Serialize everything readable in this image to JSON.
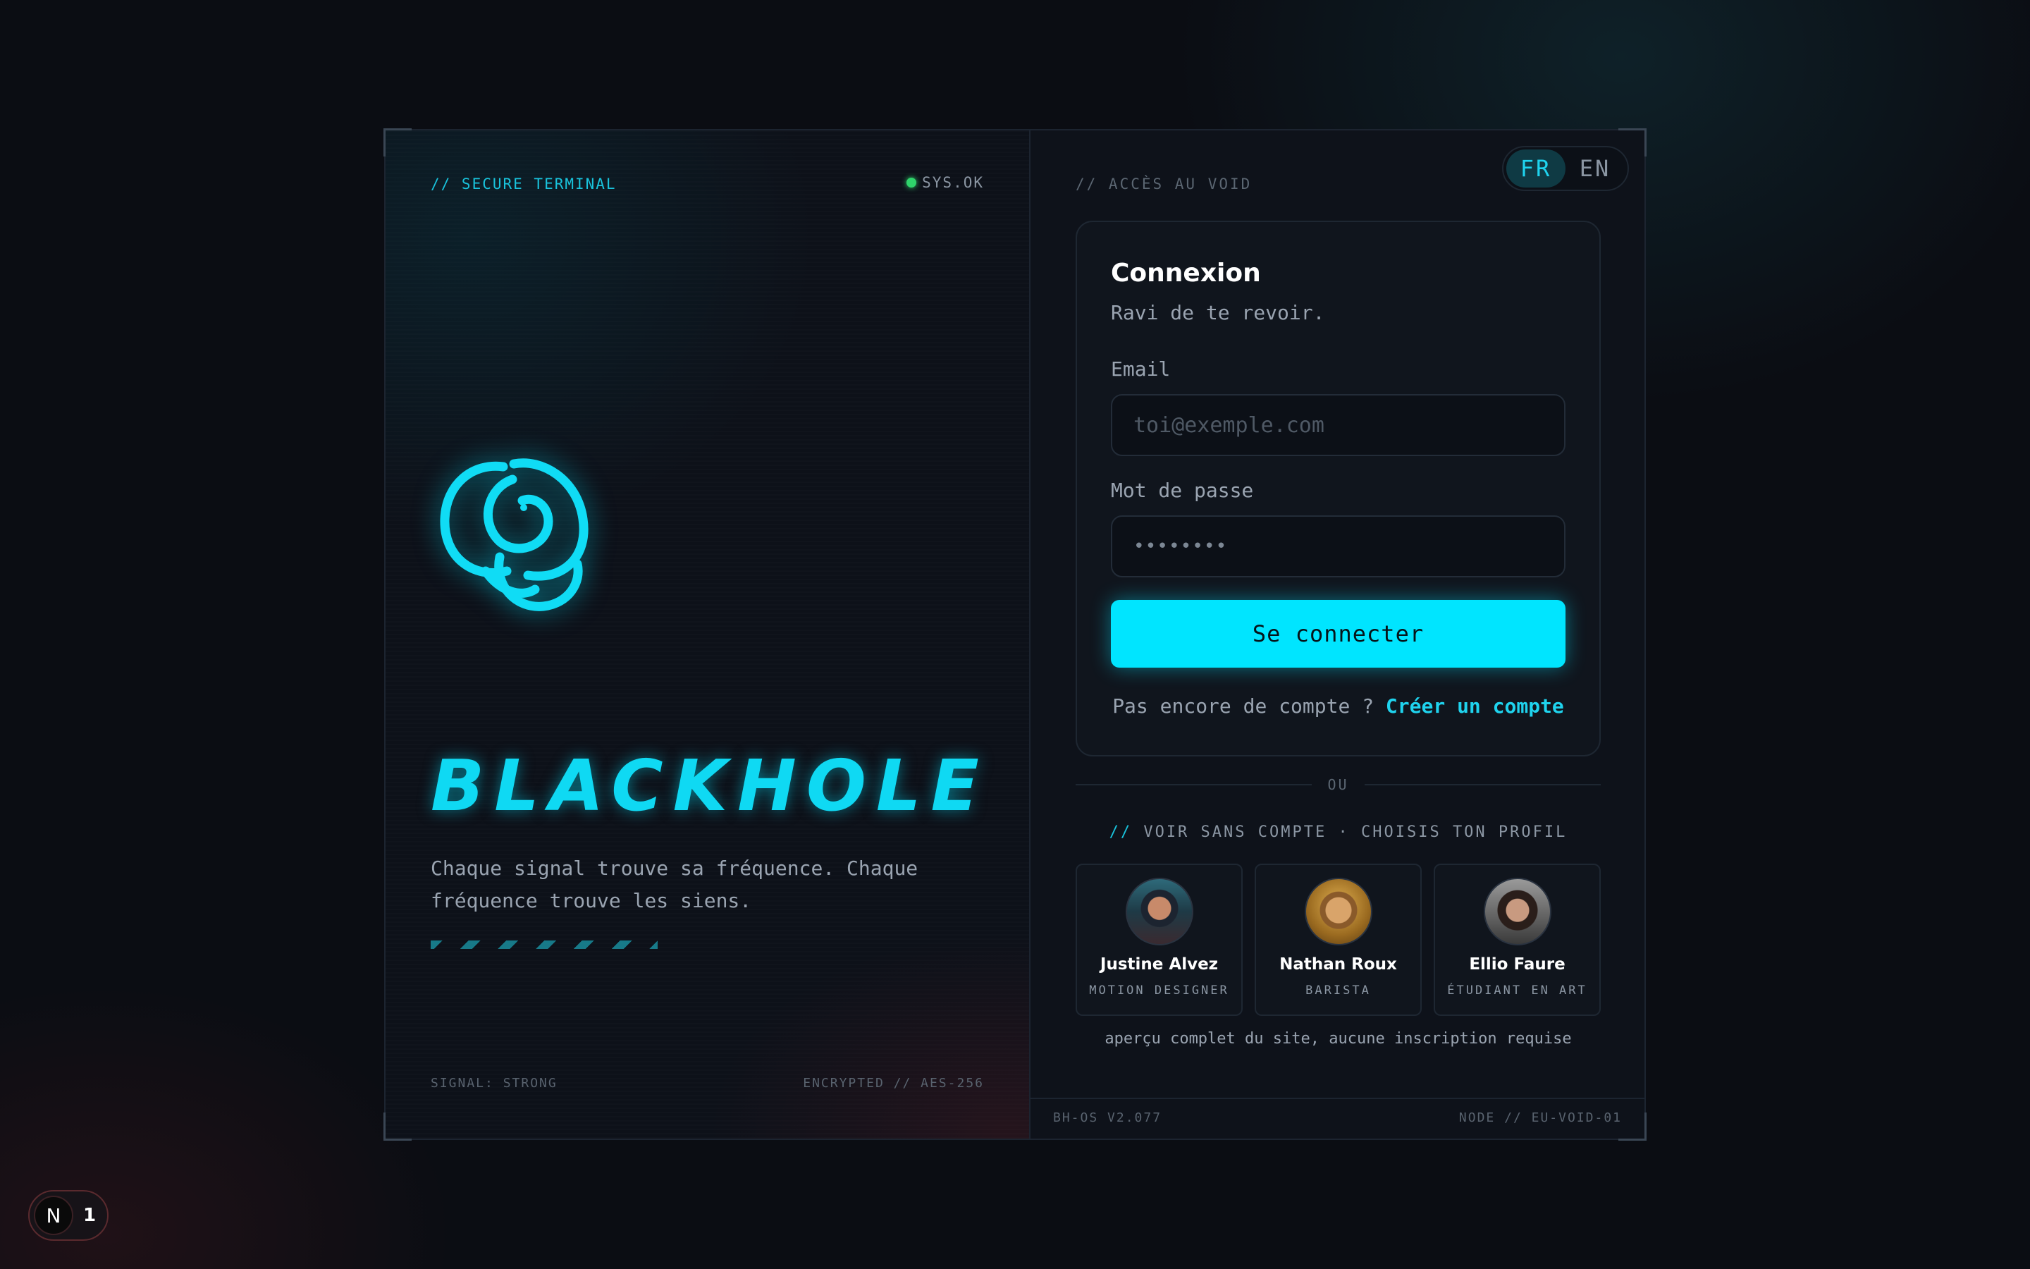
{
  "left": {
    "tag": "// SECURE TERMINAL",
    "status": "SYS.OK",
    "brand": "BLACKHOLE",
    "tagline": "Chaque signal trouve sa fréquence. Chaque fréquence trouve les siens.",
    "footer_left": "SIGNAL: STRONG",
    "footer_right": "ENCRYPTED // AES-256",
    "logo_icon": "phoenix-logo-icon"
  },
  "right": {
    "tag": "// ACCÈS AU VOID",
    "lang": {
      "fr": "FR",
      "en": "EN",
      "active": "FR"
    },
    "card": {
      "title": "Connexion",
      "subtitle": "Ravi de te revoir.",
      "email_label": "Email",
      "email_placeholder": "toi@exemple.com",
      "password_label": "Mot de passe",
      "password_value": "••••••••",
      "submit": "Se connecter",
      "no_account": "Pas encore de compte ? ",
      "create_account": "Créer un compte"
    },
    "divider": "OU",
    "guest_prefix": "//",
    "guest_tag": " VOIR SANS COMPTE · CHOISIS TON PROFIL",
    "profiles": [
      {
        "name": "Justine Alvez",
        "role": "MOTION DESIGNER"
      },
      {
        "name": "Nathan Roux",
        "role": "BARISTA"
      },
      {
        "name": "Ellio Faure",
        "role": "ÉTUDIANT EN ART"
      }
    ],
    "preview_note": "aperçu complet du site, aucune inscription requise",
    "footer_left": "BH-OS V2.077",
    "footer_right": "NODE // EU-VOID-01"
  },
  "dev_badge": {
    "letter": "N",
    "count": "1"
  },
  "colors": {
    "accent": "#00e5ff",
    "status_ok": "#2fd36b",
    "background": "#0b0d13"
  }
}
